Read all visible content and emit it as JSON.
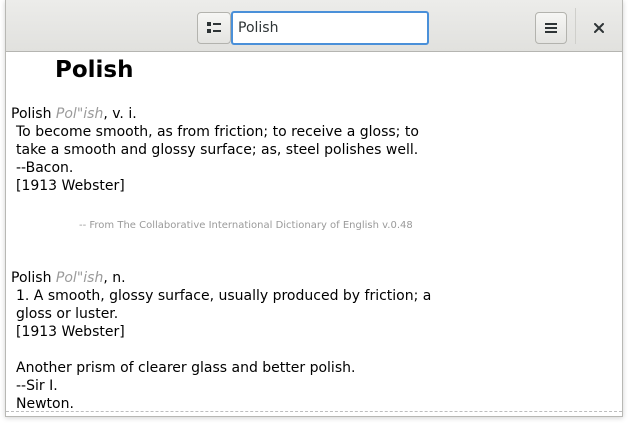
{
  "header": {
    "search_value": "Polish",
    "icons": {
      "view": "view-list-icon",
      "menu": "hamburger-menu-icon",
      "close": "close-icon"
    }
  },
  "content": {
    "word": "Polish",
    "entries": [
      {
        "headword": "Polish",
        "pronunciation": "Pol\"ish",
        "pos": ", v. i.",
        "lines": [
          "To become smooth, as from friction; to receive a gloss; to",
          "take a smooth and glossy surface; as, steel polishes well.",
          "--Bacon.",
          "[1913 Webster]"
        ]
      },
      {
        "headword": "Polish",
        "pronunciation": "Pol\"ish",
        "pos": ", n.",
        "lines": [
          "1. A smooth, glossy surface, usually produced by friction; a",
          "gloss or luster.",
          "[1913 Webster]",
          "",
          "Another prism of clearer glass and better polish.",
          "--Sir I.",
          "Newton."
        ]
      }
    ],
    "source": "-- From The Collaborative International Dictionary of English v.0.48"
  }
}
